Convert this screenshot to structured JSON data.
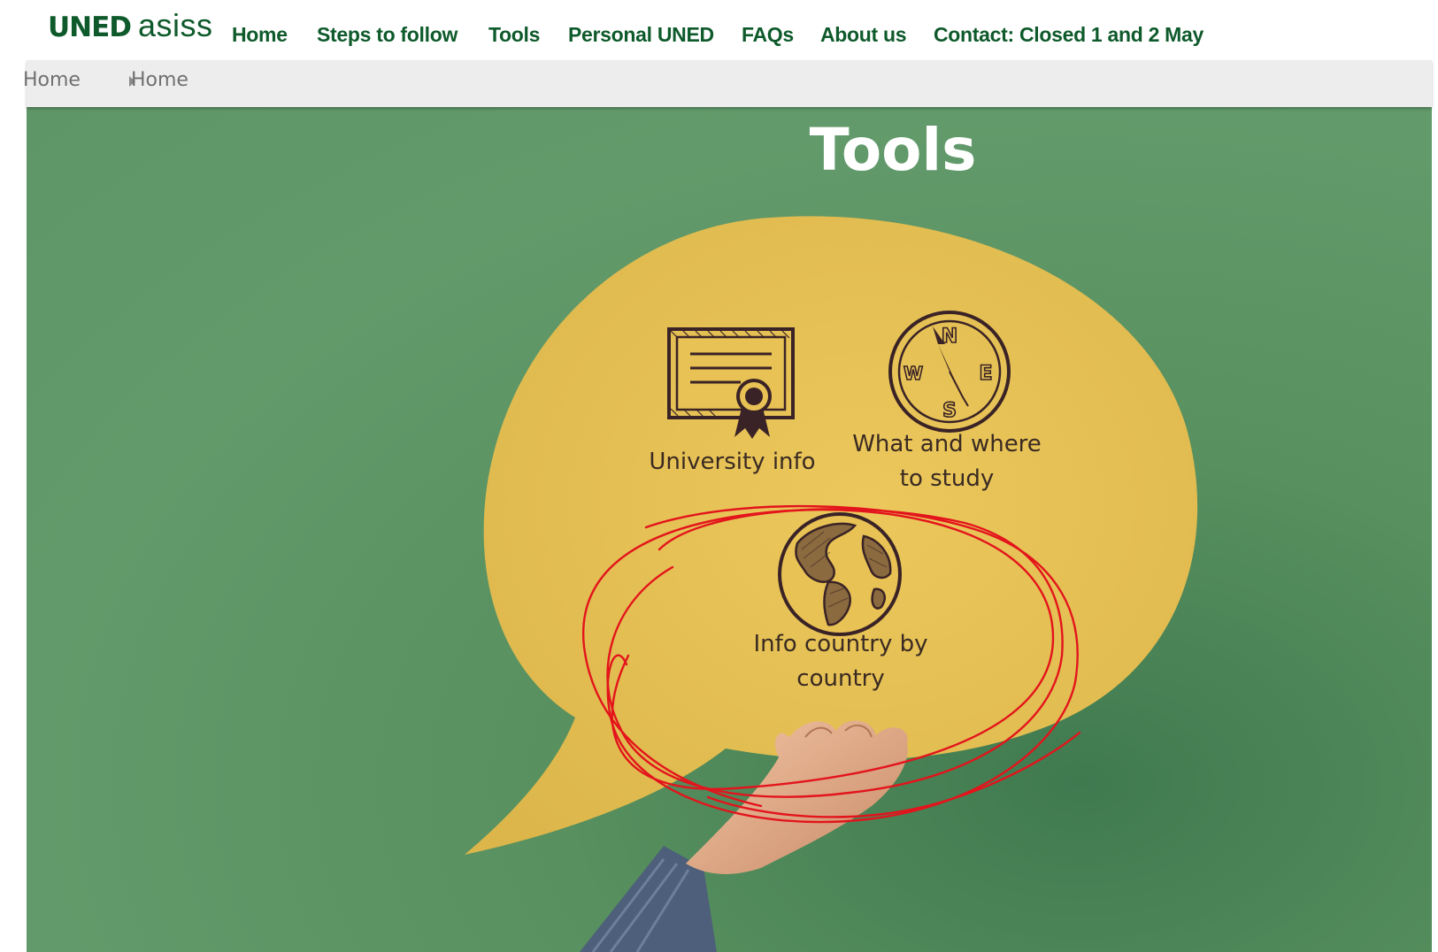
{
  "brand": {
    "logo_primary": "UNED",
    "logo_secondary": "asiss",
    "color": "#0e5a2b"
  },
  "nav": {
    "items": [
      {
        "label": "Home"
      },
      {
        "label": "Steps to follow"
      },
      {
        "label": "Tools"
      },
      {
        "label": "Personal UNED"
      },
      {
        "label": "FAQs"
      },
      {
        "label": "About us"
      },
      {
        "label": "Contact: Closed 1 and 2 May"
      }
    ]
  },
  "breadcrumb": {
    "items": [
      "Home",
      "Home"
    ]
  },
  "hero": {
    "title": "Tools",
    "background_color": "#5f9668",
    "bubble_color": "#e8c254",
    "tools": [
      {
        "label": "University info",
        "icon": "certificate-icon"
      },
      {
        "label": "What and where to study",
        "icon": "compass-icon"
      },
      {
        "label": "Info country by country",
        "icon": "globe-icon"
      }
    ],
    "annotation_color": "#e3141c"
  }
}
